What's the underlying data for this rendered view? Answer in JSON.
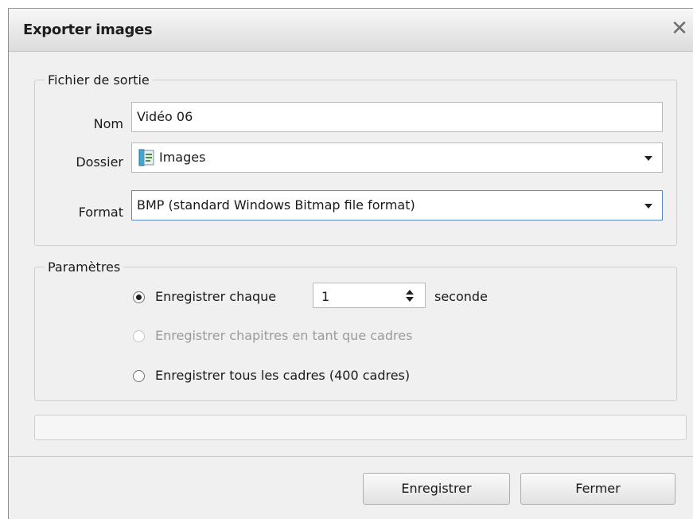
{
  "dialog": {
    "title": "Exporter images",
    "close_symbol": "✕"
  },
  "output": {
    "legend": "Fichier de sortie",
    "name_label": "Nom",
    "name_value": "Vidéo 06",
    "folder_label": "Dossier",
    "folder_value": "Images",
    "folder_icon": "folder-icon",
    "format_label": "Format",
    "format_value": "BMP (standard Windows Bitmap file format)"
  },
  "params": {
    "legend": "Paramètres",
    "opt1_label": "Enregistrer chaque",
    "interval_value": "1",
    "interval_unit": "seconde",
    "opt2_label": "Enregistrer chapitres en tant que cadres",
    "opt3_label": "Enregistrer tous les cadres (400 cadres)",
    "selected_option": 1,
    "opt2_disabled": true
  },
  "progress": {
    "fraction": 0.0
  },
  "buttons": {
    "save_label": "Enregistrer",
    "close_label": "Fermer"
  }
}
